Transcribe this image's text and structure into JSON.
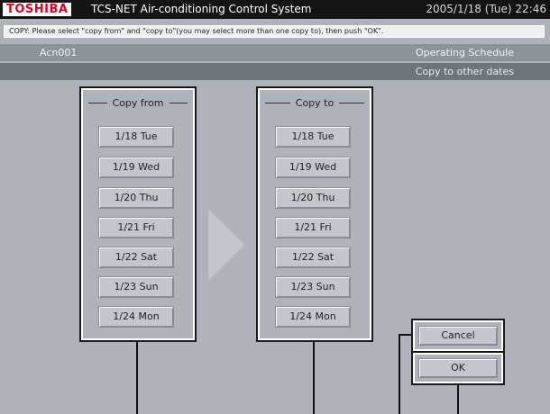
{
  "header": {
    "brand": "TOSHIBA",
    "system_title": "TCS-NET Air-conditioning Control System",
    "datetime": "2005/1/18 (Tue)  22:46"
  },
  "message": "COPY: Please select \"copy from\" and \"copy to\"(you may select more than one copy to), then push \"OK\".",
  "info_bar": {
    "unit": "Acn001",
    "screen": "Operating Schedule"
  },
  "sub_bar": {
    "mode": "Copy to other dates"
  },
  "copy_from": {
    "title": "Copy from",
    "dates": [
      "1/18 Tue",
      "1/19 Wed",
      "1/20 Thu",
      "1/21 Fri",
      "1/22 Sat",
      "1/23 Sun",
      "1/24 Mon"
    ]
  },
  "copy_to": {
    "title": "Copy to",
    "dates": [
      "1/18 Tue",
      "1/19 Wed",
      "1/20 Thu",
      "1/21 Fri",
      "1/22 Sat",
      "1/23 Sun",
      "1/24 Mon"
    ]
  },
  "actions": {
    "cancel": "Cancel",
    "ok": "OK"
  },
  "icons": {
    "brand_color": "#e0001b",
    "arrow": "right-arrow-icon"
  }
}
